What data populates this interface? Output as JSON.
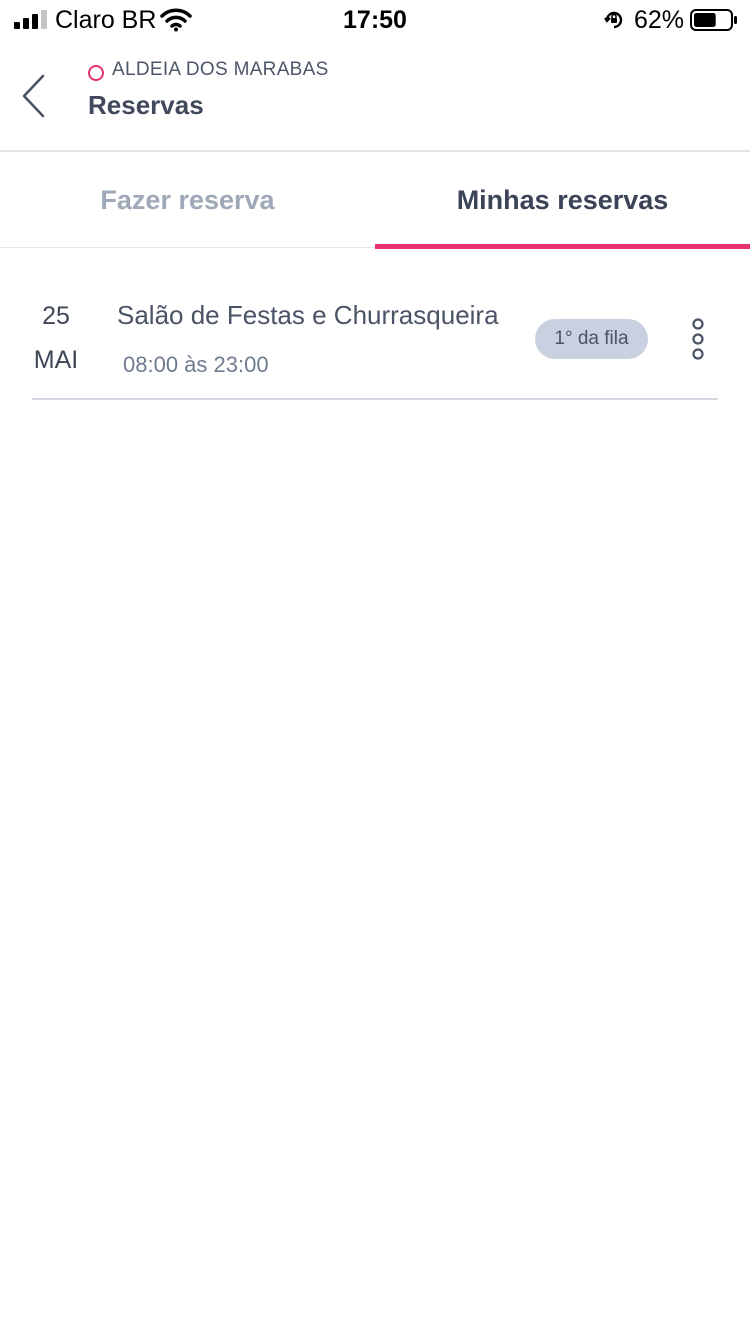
{
  "status_bar": {
    "carrier": "Claro BR",
    "time": "17:50",
    "battery_percent": "62%",
    "signal_bars": 3,
    "battery_level": 0.62,
    "icons": [
      "signal-icon",
      "wifi-icon",
      "orientation-lock-icon",
      "battery-icon"
    ]
  },
  "header": {
    "back_icon": "chevron-left-icon",
    "org_icon": "circle-icon",
    "org_name": "ALDEIA DOS MARABAS",
    "title": "Reservas"
  },
  "tabs": [
    {
      "label": "Fazer reserva",
      "active": false
    },
    {
      "label": "Minhas reservas",
      "active": true
    }
  ],
  "reservations": [
    {
      "day": "25",
      "month": "MAI",
      "name": "Salão de Festas e Churrasqueira",
      "hours": "08:00 às 23:00",
      "badge": "1° da fila",
      "menu_icon": "more-vertical-icon"
    }
  ],
  "colors": {
    "accent": "#e6336e",
    "badge_bg": "#c9d1e1",
    "text_primary": "#414a5c",
    "text_muted": "#9ea8b7"
  }
}
